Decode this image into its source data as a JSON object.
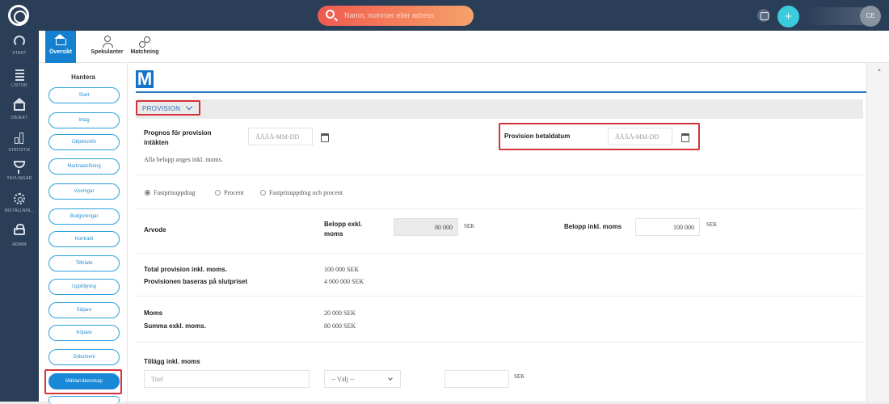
{
  "topbar": {
    "search_placeholder": "Namn, nummer eller adress",
    "avatar_initials": "CE",
    "icons": [
      "logo-icon",
      "search-icon",
      "calendar-icon",
      "plus-icon"
    ]
  },
  "leftnav": {
    "items": [
      {
        "label": "START",
        "icon": "gauge-icon"
      },
      {
        "label": "LISTOR",
        "icon": "list-icon"
      },
      {
        "label": "OBJEKT",
        "icon": "house-icon"
      },
      {
        "label": "STATISTIK",
        "icon": "bar-chart-icon"
      },
      {
        "label": "TÄVLINGAR",
        "icon": "trophy-icon"
      },
      {
        "label": "INSTÄLLNIN...",
        "icon": "gear-icon"
      },
      {
        "label": "ADMIN",
        "icon": "lock-icon"
      }
    ]
  },
  "subnav": {
    "tabs": [
      {
        "label": "Översikt",
        "active": true
      },
      {
        "label": "Spekulanter",
        "active": false
      },
      {
        "label": "Matchning",
        "active": false
      }
    ]
  },
  "hantera": {
    "title": "Hantera",
    "buttons": [
      "Start",
      "Intag",
      "Objektsinfo",
      "Marknadsföring",
      "Visningar",
      "Budgivningar",
      "Kontrakt",
      "Tillträde",
      "Uppföljning",
      "Säljare",
      "Köpare",
      "Dokument",
      "Mäklarräkenskap"
    ],
    "active": "Mäklarräkenskap"
  },
  "main": {
    "logo_letter": "M",
    "section_label": "PROVISION",
    "prognos_label_1": "Prognos för provision",
    "prognos_label_2": "intäkten",
    "date_placeholder": "ÅÅÅÅ-MM-DD",
    "betaldatum_label": "Provision betaldatum",
    "note": "Alla belopp anges inkl. moms.",
    "radio_options": [
      "Fastprisuppdrag",
      "Procent",
      "Fastprisuppdrag och procent"
    ],
    "radio_selected": "Fastprisuppdrag",
    "arvode_label": "Arvode",
    "belopp_exkl_label_1": "Belopp exkl.",
    "belopp_exkl_label_2": "moms",
    "belopp_exkl_value": "80 000",
    "currency": "SEK",
    "belopp_inkl_label": "Belopp inkl. moms",
    "belopp_inkl_value": "100 000",
    "total_label": "Total provision inkl. moms.",
    "total_value": "100 000 SEK",
    "baseras_label": "Provisionen baseras på slutpriset",
    "baseras_value": "4 000 000 SEK",
    "moms_label": "Moms",
    "moms_value": "20 000 SEK",
    "summa_label": "Summa exkl. moms.",
    "summa_value": "80 000 SEK",
    "tillagg_label": "Tillägg inkl. moms",
    "titel_placeholder": "Titel",
    "valj_label": "-- Välj --"
  },
  "colors": {
    "nav_bg": "#2b3e58",
    "accent": "#1988d6",
    "highlight": "#d6323a",
    "search_gradient_start": "#ee5a50",
    "plus": "#3ccbdc"
  }
}
